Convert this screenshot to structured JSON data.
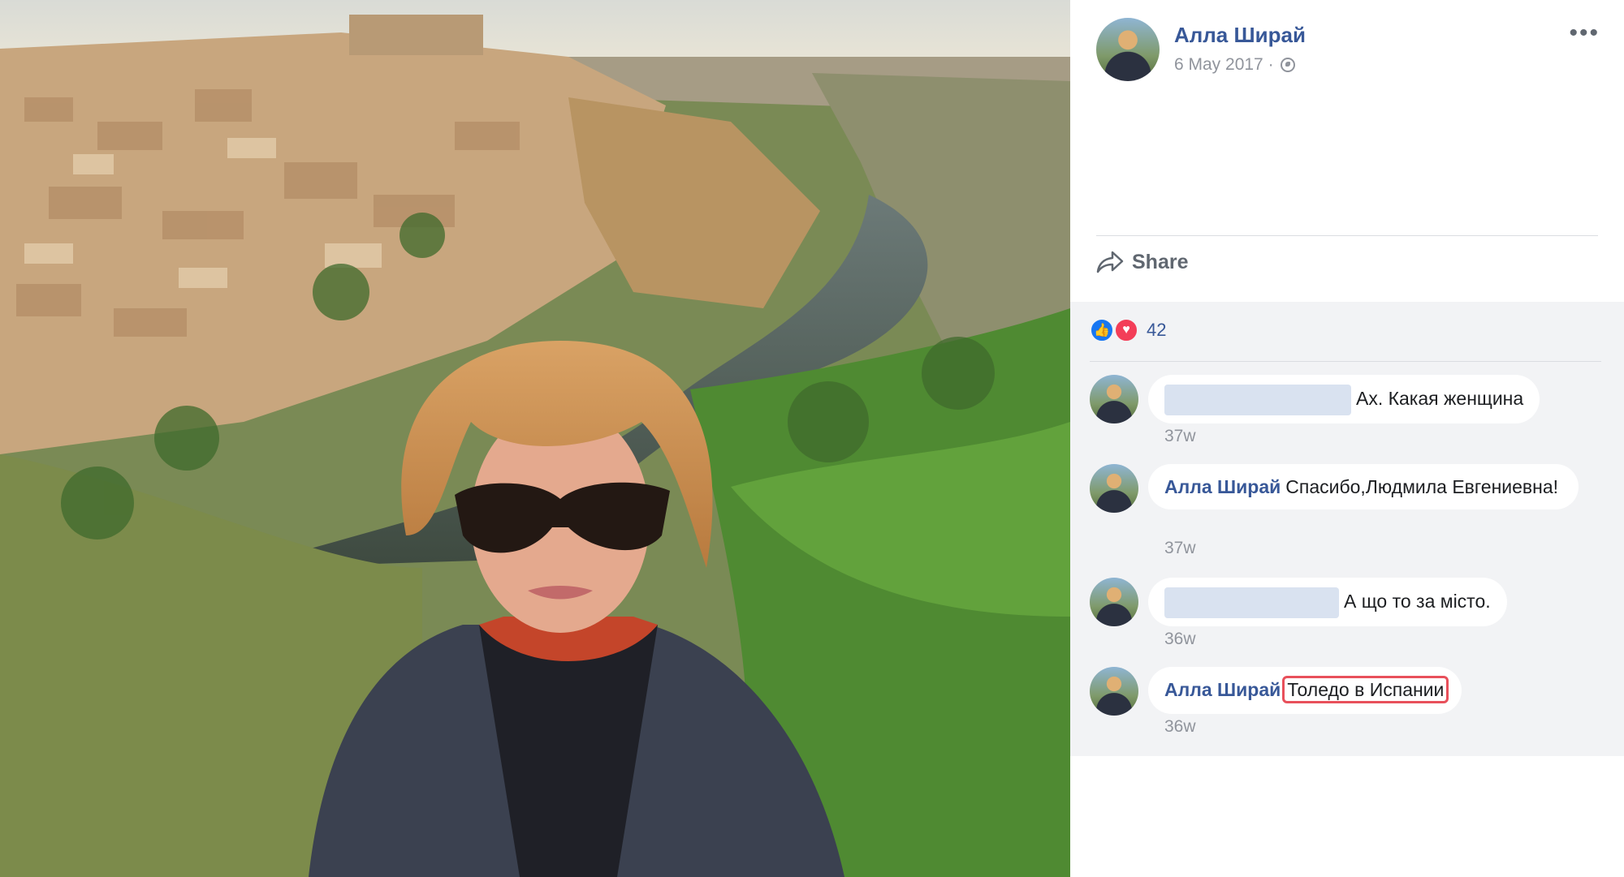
{
  "post": {
    "author": "Алла Ширай",
    "date": "6 May 2017 ·",
    "privacy_icon": "globe-icon",
    "more_icon": "more-icon",
    "share_label": "Share"
  },
  "reactions": {
    "types": [
      "like",
      "love"
    ],
    "count": "42"
  },
  "comments": [
    {
      "author": "",
      "author_redacted": true,
      "text": "Ах. Какая женщина",
      "time": "37w"
    },
    {
      "author": "Алла Ширай",
      "text": "Спасибо,Людмила Евгениевна!",
      "time": "37w"
    },
    {
      "author": "",
      "author_redacted": true,
      "text": "А що то за місто.",
      "time": "36w"
    },
    {
      "author": "Алла Ширай",
      "text": "Толедо в Испании",
      "time": "36w",
      "highlighted": true
    }
  ],
  "colors": {
    "link": "#385898",
    "meta": "#90949c",
    "comments_bg": "#f2f3f5",
    "highlight_box": "#e8505b",
    "like": "#1877f2",
    "love": "#f33e58"
  }
}
